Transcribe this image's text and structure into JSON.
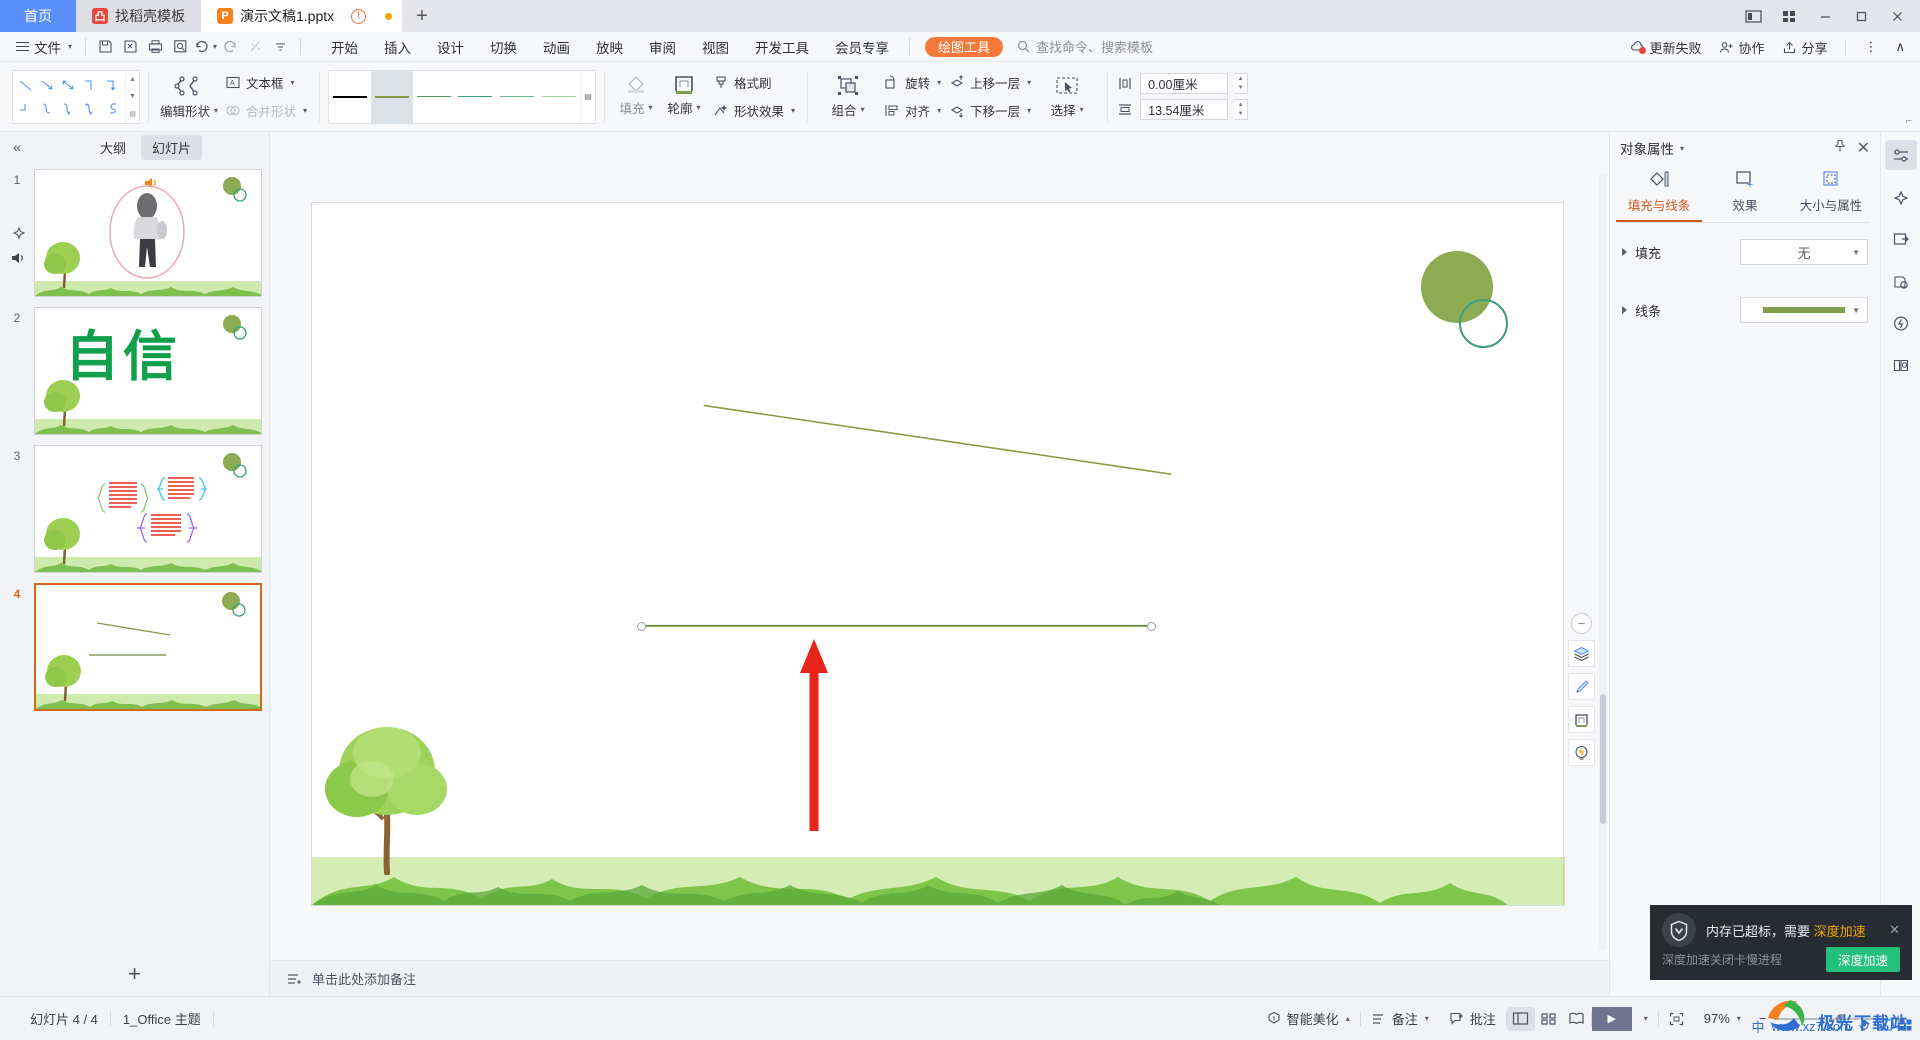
{
  "titlebar": {
    "tabs": [
      {
        "label": "首页",
        "icon": "home-tab",
        "type": "home"
      },
      {
        "label": "找稻壳模板",
        "icon": "docer-icon",
        "type": "template"
      },
      {
        "label": "演示文稿1.pptx",
        "icon": "wpp-icon",
        "type": "document"
      }
    ],
    "new_tab_label": "+",
    "warning_icon": "!",
    "window_controls": [
      "screen-icon",
      "layout-icon",
      "grid-icon",
      "minimize",
      "maximize",
      "close"
    ]
  },
  "menubar": {
    "file_label": "文件",
    "quick_icons": [
      "save-icon",
      "save-as-icon",
      "print-icon",
      "print-preview-icon",
      "undo-icon",
      "redo-icon",
      "format-clear-icon",
      "customize-icon"
    ],
    "items": [
      "开始",
      "插入",
      "设计",
      "切换",
      "动画",
      "放映",
      "审阅",
      "视图",
      "开发工具",
      "会员专享"
    ],
    "pill_label": "绘图工具",
    "search_placeholder": "查找命令、搜索模板",
    "right_items": [
      {
        "label": "更新失败",
        "icon": "cloud-warning-icon"
      },
      {
        "label": "协作",
        "icon": "collaborate-icon"
      },
      {
        "label": "分享",
        "icon": "share-icon"
      }
    ],
    "more_icon": "⋮",
    "collapse_icon": "∧"
  },
  "ribbon": {
    "shape_gallery_name": "line-shapes-gallery",
    "edit_shape_label": "编辑形状",
    "textbox_label": "文本框",
    "merge_shape_label": "合并形状",
    "line_gallery_name": "line-style-gallery",
    "line_styles": [
      {
        "color": "#000000",
        "selected": false
      },
      {
        "color": "#8a9a46",
        "selected": true
      },
      {
        "color": "#4f9d5f",
        "selected": false
      },
      {
        "color": "#3d9d86",
        "selected": false
      },
      {
        "color": "#6cb88f",
        "selected": false
      },
      {
        "color": "#9cd1a0",
        "selected": false
      }
    ],
    "fill_label": "填充",
    "outline_label": "轮廓",
    "format_painter_label": "格式刷",
    "shape_effect_label": "形状效果",
    "group_label": "组合",
    "align_label": "对齐",
    "rotate_label": "旋转",
    "bring_forward_label": "上移一层",
    "send_backward_label": "下移一层",
    "select_label": "选择",
    "height_value": "0.00厘米",
    "width_value": "13.54厘米"
  },
  "left_panel": {
    "collapse_icon": "«",
    "tabs": [
      {
        "label": "大纲",
        "active": false
      },
      {
        "label": "幻灯片",
        "active": true
      }
    ],
    "slides": [
      {
        "num": "1",
        "selected": false,
        "kind": "figure"
      },
      {
        "num": "2",
        "selected": false,
        "kind": "title",
        "text": "自信"
      },
      {
        "num": "3",
        "selected": false,
        "kind": "brackets"
      },
      {
        "num": "4",
        "selected": true,
        "kind": "lines"
      }
    ],
    "extra_icons": [
      "animation-star-icon",
      "audio-icon"
    ],
    "add_slide_label": "+"
  },
  "canvas": {
    "slide_number": "4",
    "shapes": {
      "big_circle_color": "#8cab52",
      "ring_circle_color": "#3d9d80",
      "line_color": "#8a9a46",
      "arrow_color": "#e8241b"
    },
    "float_tools": [
      {
        "icon": "collapse-minus-icon"
      },
      {
        "icon": "layers-icon"
      },
      {
        "icon": "brush-icon"
      },
      {
        "icon": "shape-outline-icon"
      },
      {
        "icon": "idea-bulb-icon"
      }
    ],
    "notes_placeholder": "单击此处添加备注",
    "notes_icon": "notes-icon"
  },
  "right_panel": {
    "title": "对象属性",
    "pin_icon": "pin-icon",
    "close_icon": "✕",
    "tabs": [
      {
        "label": "填充与线条",
        "icon": "fill-line-icon",
        "active": true
      },
      {
        "label": "效果",
        "icon": "effects-icon",
        "active": false
      },
      {
        "label": "大小与属性",
        "icon": "size-props-icon",
        "active": false
      }
    ],
    "properties": [
      {
        "label": "填充",
        "value": "无",
        "type": "text"
      },
      {
        "label": "线条",
        "value": "",
        "type": "swatch",
        "color": "#7f9e4d"
      }
    ]
  },
  "rail": {
    "icons": [
      {
        "name": "properties-icon",
        "active": true
      },
      {
        "name": "magic-star-icon",
        "active": false
      },
      {
        "name": "export-slide-icon",
        "active": false
      },
      {
        "name": "material-icon",
        "active": false
      },
      {
        "name": "lightning-icon",
        "active": false
      },
      {
        "name": "reading-icon",
        "active": false
      }
    ]
  },
  "statusbar": {
    "slide_count": "幻灯片 4 / 4",
    "theme": "1_Office 主题",
    "beautify_label": "智能美化",
    "notes_label": "备注",
    "comment_label": "批注",
    "view_buttons": [
      "normal-view-icon",
      "slide-sorter-icon",
      "reading-view-icon"
    ],
    "play_icon": "▶",
    "fit_icon": "fit-screen-icon",
    "zoom_level": "97%",
    "zoom_minus": "−",
    "zoom_plus": "+"
  },
  "popup": {
    "icon": "shield-icon",
    "title_text": "内存已超标，需要",
    "title_accent": "深度加速",
    "subtitle": "深度加速关闭卡慢进程",
    "button_label": "深度加速",
    "close": "✕",
    "button_color": "#22c07a",
    "accent_color": "#f0a500"
  },
  "watermark": {
    "text": "极光下载站",
    "url": "www.xz7.com"
  }
}
